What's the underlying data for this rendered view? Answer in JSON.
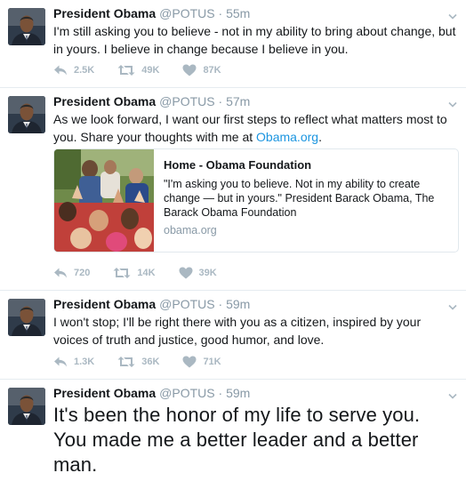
{
  "tweets": [
    {
      "name": "President Obama",
      "handle": "@POTUS",
      "dot": "·",
      "time": "55m",
      "text": "I'm still asking you to believe - not in my ability to bring about change, but in yours. I believe in change because I believe in you.",
      "replies": "2.5K",
      "retweets": "49K",
      "likes": "87K"
    },
    {
      "name": "President Obama",
      "handle": "@POTUS",
      "dot": "·",
      "time": "57m",
      "text": "As we look forward, I want our first steps to reflect what matters most to you. Share your thoughts with me at",
      "link": "Obama.org",
      "text_end": ".",
      "card": {
        "title": "Home - Obama Foundation",
        "description": "\"I'm asking you to believe. Not in my ability to create change — but in yours.\" President Barack Obama, The Barack Obama Foundation",
        "domain": "obama.org"
      },
      "replies": "720",
      "retweets": "14K",
      "likes": "39K"
    },
    {
      "name": "President Obama",
      "handle": "@POTUS",
      "dot": "·",
      "time": "59m",
      "text": "I won't stop; I'll be right there with you as a citizen, inspired by your voices of truth and justice, good humor, and love.",
      "replies": "1.3K",
      "retweets": "36K",
      "likes": "71K"
    },
    {
      "name": "President Obama",
      "handle": "@POTUS",
      "dot": "·",
      "time": "59m",
      "text": "It's been the honor of my life to serve you. You made me a better leader and a better man."
    }
  ],
  "colors": {
    "link": "#1b95e0",
    "muted": "#8899a6",
    "action": "#aab8c2",
    "border": "#e6ecf0"
  },
  "icons": [
    "avatar",
    "caret-down-icon",
    "reply-icon",
    "retweet-icon",
    "like-icon"
  ]
}
